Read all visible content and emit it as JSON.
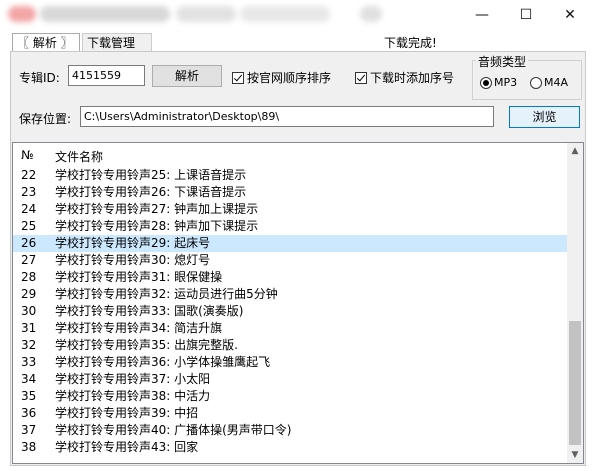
{
  "window": {
    "minimize_glyph": "—",
    "maximize_glyph": "☐",
    "close_glyph": "✕"
  },
  "tabs": [
    {
      "label": "〖 解析 〗",
      "active": true
    },
    {
      "label": "下载管理",
      "active": false
    }
  ],
  "status_text": "下载完成!",
  "album": {
    "label": "专辑ID:",
    "value": "4151559",
    "parse_button": "解析",
    "official_order_label": "按官网顺序排序",
    "official_order_checked": true,
    "add_index_label": "下载时添加序号",
    "add_index_checked": true
  },
  "audio_type": {
    "title": "音频类型",
    "options": [
      "MP3",
      "M4A"
    ],
    "selected": "MP3"
  },
  "save": {
    "label": "保存位置:",
    "path": "C:\\Users\\Administrator\\Desktop\\89\\",
    "browse_button": "浏览"
  },
  "list": {
    "columns": [
      "№",
      "文件名称"
    ],
    "rows": [
      {
        "no": "22",
        "name": "学校打铃专用铃声25: 上课语音提示"
      },
      {
        "no": "23",
        "name": "学校打铃专用铃声26: 下课语音提示"
      },
      {
        "no": "24",
        "name": "学校打铃专用铃声27: 钟声加上课提示"
      },
      {
        "no": "25",
        "name": "学校打铃专用铃声28: 钟声加下课提示"
      },
      {
        "no": "26",
        "name": "学校打铃专用铃声29: 起床号",
        "selected": true
      },
      {
        "no": "27",
        "name": "学校打铃专用铃声30: 熄灯号"
      },
      {
        "no": "28",
        "name": "学校打铃专用铃声31: 眼保健操"
      },
      {
        "no": "29",
        "name": "学校打铃专用铃声32: 运动员进行曲5分钟"
      },
      {
        "no": "30",
        "name": "学校打铃专用铃声33: 国歌(演奏版)"
      },
      {
        "no": "31",
        "name": "学校打铃专用铃声34: 简洁升旗"
      },
      {
        "no": "32",
        "name": "学校打铃专用铃声35: 出旗完整版."
      },
      {
        "no": "33",
        "name": "学校打铃专用铃声36: 小学体操雏鹰起飞"
      },
      {
        "no": "34",
        "name": "学校打铃专用铃声37: 小太阳"
      },
      {
        "no": "35",
        "name": "学校打铃专用铃声38: 中活力"
      },
      {
        "no": "36",
        "name": "学校打铃专用铃声39: 中招"
      },
      {
        "no": "37",
        "name": "学校打铃专用铃声40: 广播体操(男声带口令)"
      },
      {
        "no": "38",
        "name": "学校打铃专用铃声43: 回家"
      }
    ]
  },
  "colors": {
    "selection": "#cce8ff",
    "button_default_border": "#0078d7",
    "panel_bg": "#f0f0f0"
  }
}
